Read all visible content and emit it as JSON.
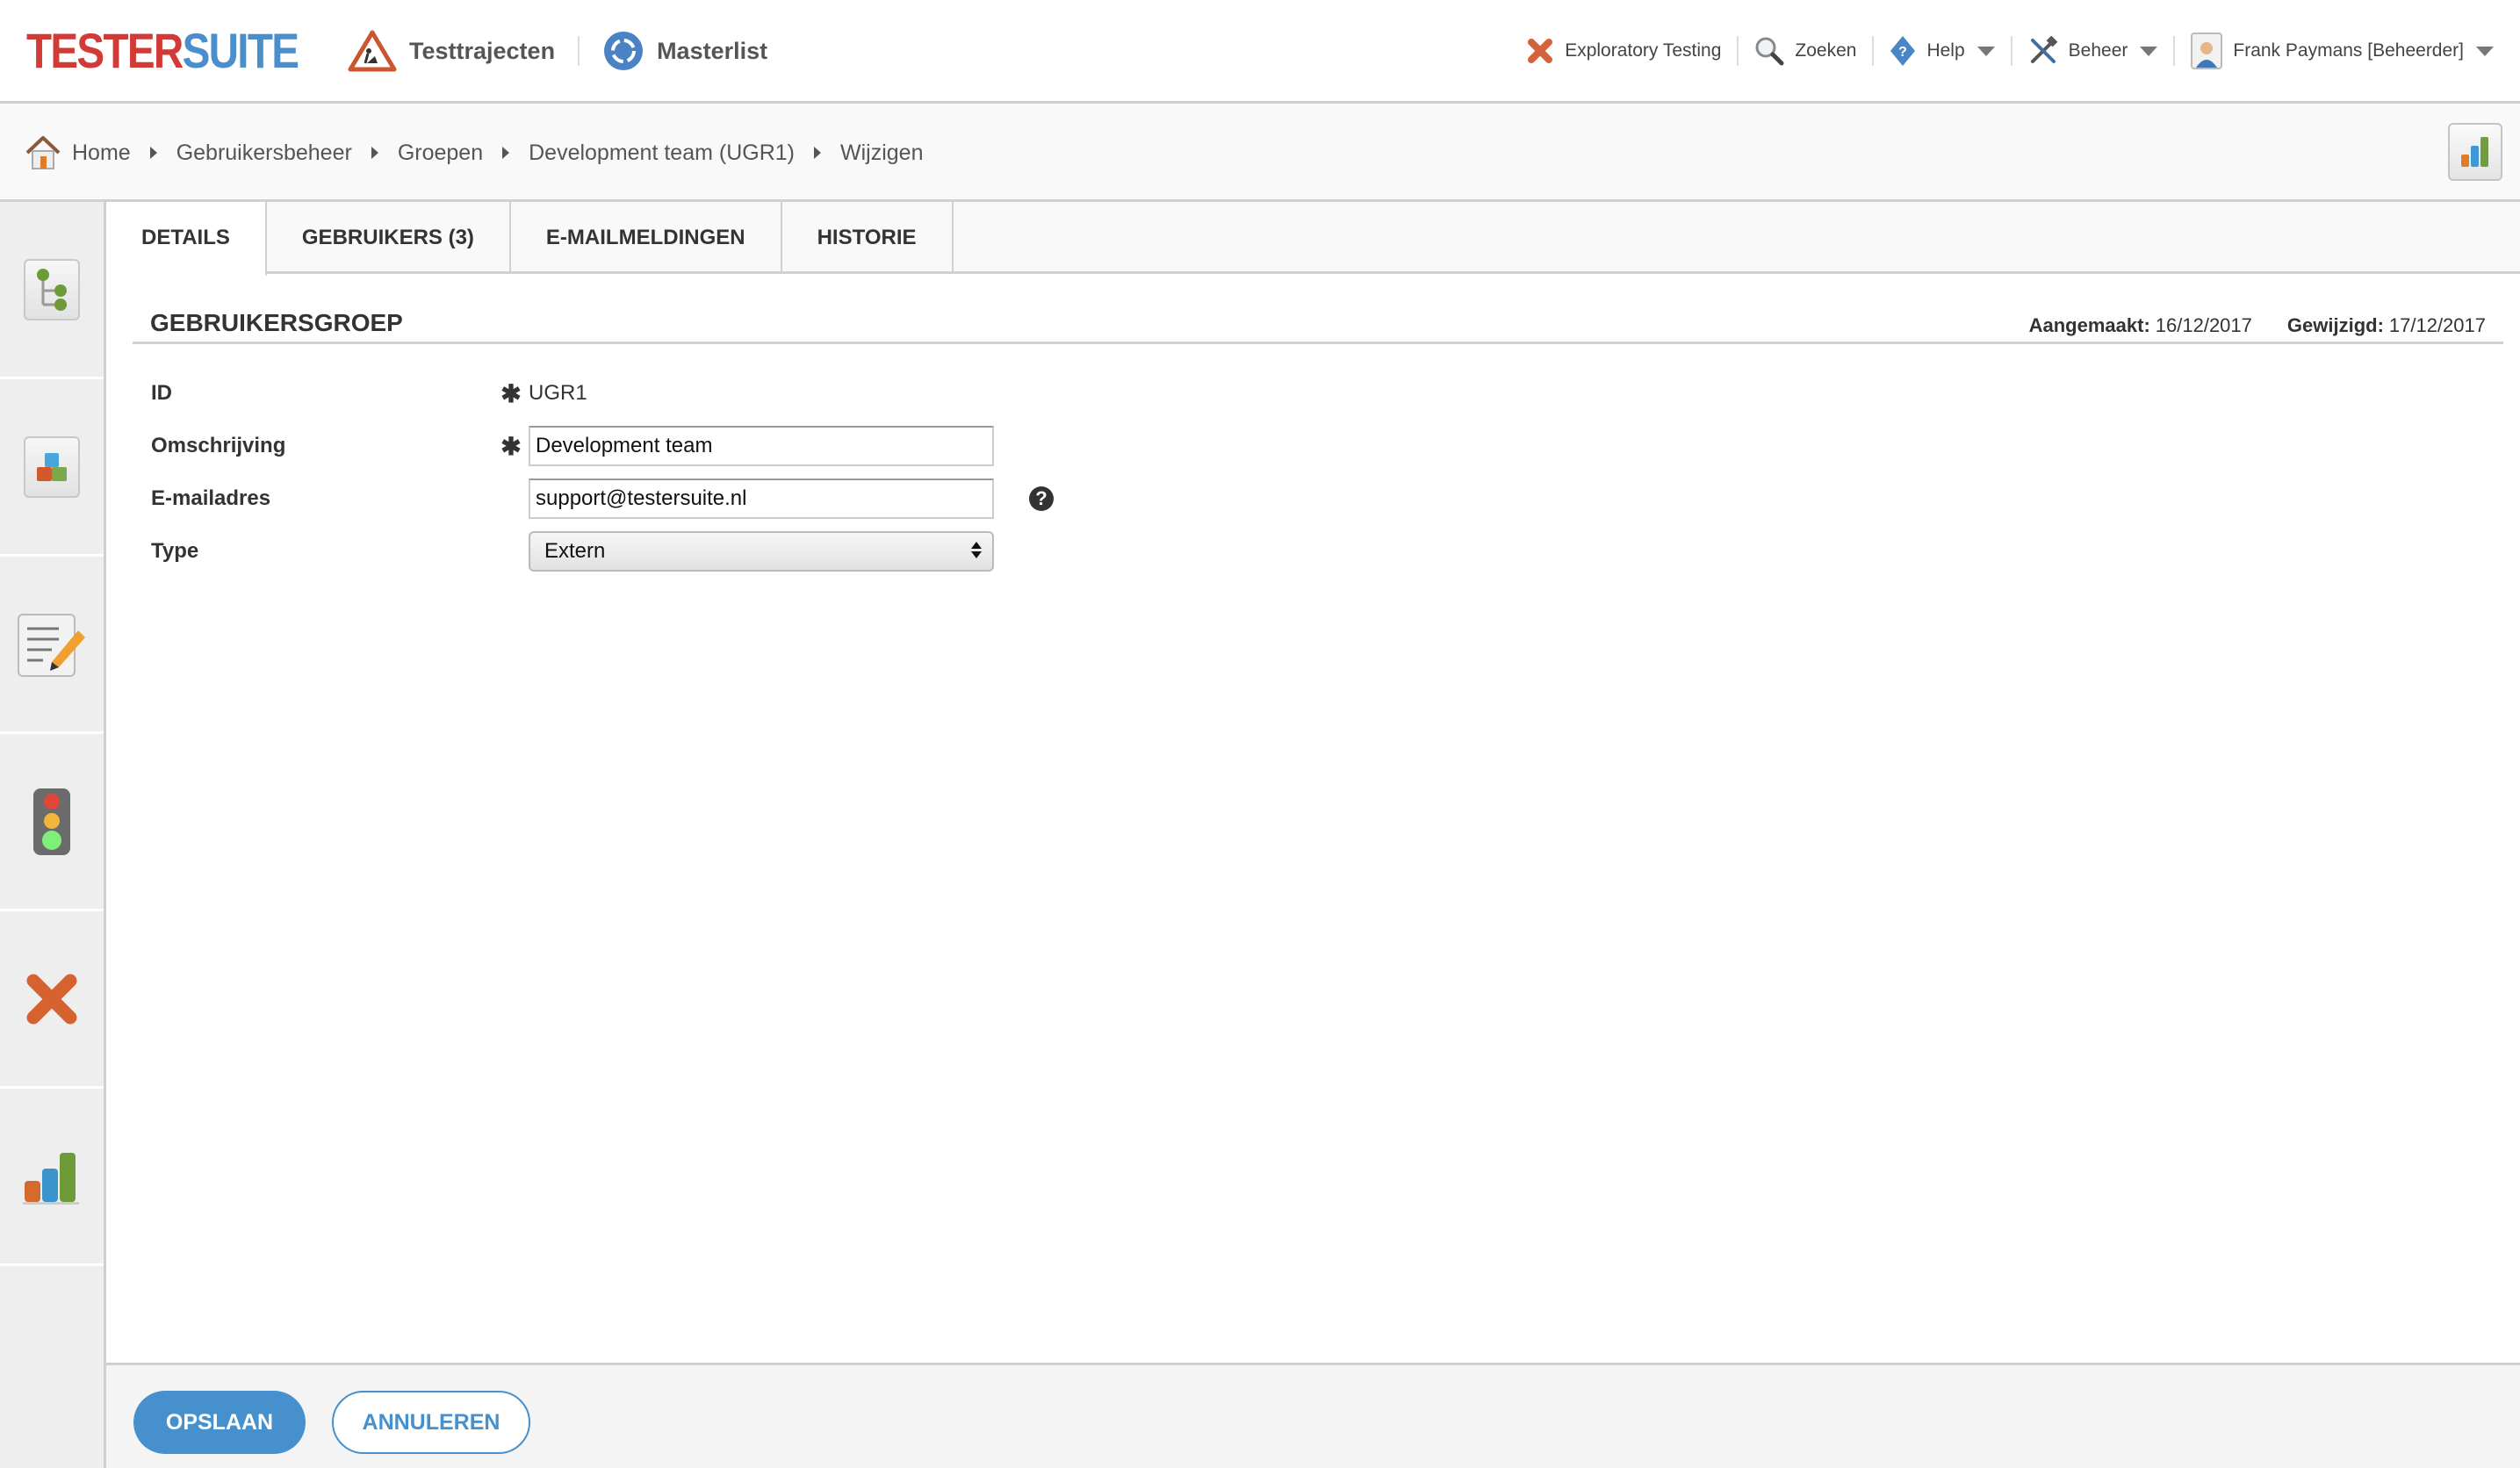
{
  "header": {
    "logo": {
      "part1": "TESTER",
      "part2": "SUITE"
    },
    "main_nav": [
      {
        "label": "Testtrajecten",
        "icon": "roadwork-sign-icon"
      },
      {
        "label": "Masterlist",
        "icon": "roundabout-icon"
      }
    ],
    "tools": [
      {
        "label": "Exploratory Testing",
        "icon": "x-icon",
        "dropdown": false
      },
      {
        "label": "Zoeken",
        "icon": "magnifier-icon",
        "dropdown": false
      },
      {
        "label": "Help",
        "icon": "help-diamond-icon",
        "dropdown": true
      },
      {
        "label": "Beheer",
        "icon": "tools-icon",
        "dropdown": true
      },
      {
        "label": "Frank Paymans [Beheerder]",
        "icon": "user-icon",
        "dropdown": true
      }
    ]
  },
  "breadcrumb": [
    {
      "label": "Home"
    },
    {
      "label": "Gebruikersbeheer"
    },
    {
      "label": "Groepen"
    },
    {
      "label": "Development team (UGR1)"
    },
    {
      "label": "Wijzigen"
    }
  ],
  "sidebar": {
    "items": [
      {
        "name": "tree",
        "icon": "tree-structure-icon"
      },
      {
        "name": "blocks",
        "icon": "blocks-document-icon"
      },
      {
        "name": "edit",
        "icon": "document-edit-icon"
      },
      {
        "name": "status",
        "icon": "traffic-light-icon"
      },
      {
        "name": "exploratory",
        "icon": "x-icon"
      },
      {
        "name": "reports",
        "icon": "bar-chart-icon"
      }
    ]
  },
  "tabs": [
    {
      "label": "DETAILS",
      "active": true
    },
    {
      "label": "GEBRUIKERS (3)",
      "active": false
    },
    {
      "label": "E-MAILMELDINGEN",
      "active": false
    },
    {
      "label": "HISTORIE",
      "active": false
    }
  ],
  "section": {
    "title": "GEBRUIKERSGROEP",
    "created_label": "Aangemaakt:",
    "created_value": "16/12/2017",
    "modified_label": "Gewijzigd:",
    "modified_value": "17/12/2017"
  },
  "form": {
    "required_marker": "✱",
    "id": {
      "label": "ID",
      "value": "UGR1",
      "required": true
    },
    "description": {
      "label": "Omschrijving",
      "value": "Development team",
      "required": true
    },
    "email": {
      "label": "E-mailadres",
      "value": "support@testersuite.nl",
      "required": false,
      "help": "?"
    },
    "type": {
      "label": "Type",
      "value": "Extern"
    }
  },
  "footer": {
    "save_label": "OPSLAAN",
    "cancel_label": "ANNULEREN"
  },
  "colors": {
    "brand_red": "#d13a36",
    "brand_blue": "#4a8ecb",
    "button_primary": "#4590cd"
  }
}
